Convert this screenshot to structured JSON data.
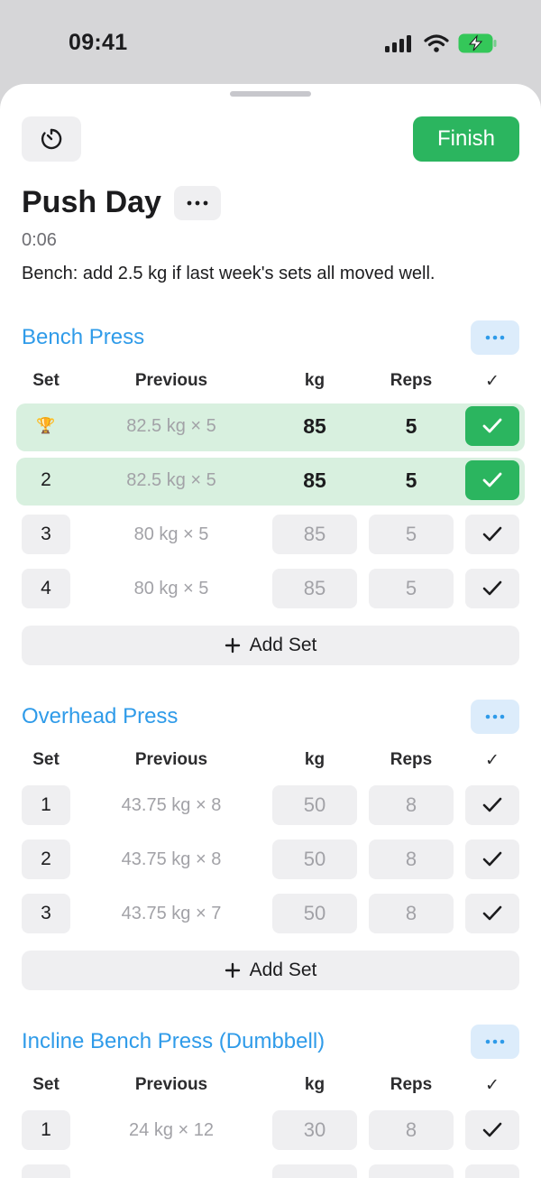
{
  "status": {
    "time": "09:41"
  },
  "workout": {
    "title": "Push Day",
    "elapsed": "0:06",
    "note": "Bench: add 2.5 kg if last week's sets all moved well.",
    "finish_label": "Finish"
  },
  "columns": {
    "set": "Set",
    "previous": "Previous",
    "kg": "kg",
    "reps": "Reps",
    "check": "✓"
  },
  "add_set_label": "Add Set",
  "exercises": [
    {
      "name": "Bench Press",
      "sets": [
        {
          "set": "🏆",
          "previous": "82.5 kg × 5",
          "kg": "85",
          "reps": "5",
          "done": true
        },
        {
          "set": "2",
          "previous": "82.5 kg × 5",
          "kg": "85",
          "reps": "5",
          "done": true
        },
        {
          "set": "3",
          "previous": "80 kg × 5",
          "kg": "85",
          "reps": "5",
          "done": false
        },
        {
          "set": "4",
          "previous": "80 kg × 5",
          "kg": "85",
          "reps": "5",
          "done": false
        }
      ]
    },
    {
      "name": "Overhead Press",
      "sets": [
        {
          "set": "1",
          "previous": "43.75 kg × 8",
          "kg": "50",
          "reps": "8",
          "done": false
        },
        {
          "set": "2",
          "previous": "43.75 kg × 8",
          "kg": "50",
          "reps": "8",
          "done": false
        },
        {
          "set": "3",
          "previous": "43.75 kg × 7",
          "kg": "50",
          "reps": "8",
          "done": false
        }
      ]
    },
    {
      "name": "Incline Bench Press (Dumbbell)",
      "sets": [
        {
          "set": "1",
          "previous": "24 kg × 12",
          "kg": "30",
          "reps": "8",
          "done": false
        },
        {
          "set": "",
          "previous": "",
          "kg": "",
          "reps": "",
          "done": false
        }
      ]
    }
  ],
  "colors": {
    "accent_blue": "#2f9be9",
    "finish_green": "#2bb55f",
    "done_row_bg": "#d8f0df",
    "trophy": "#f0b323"
  }
}
